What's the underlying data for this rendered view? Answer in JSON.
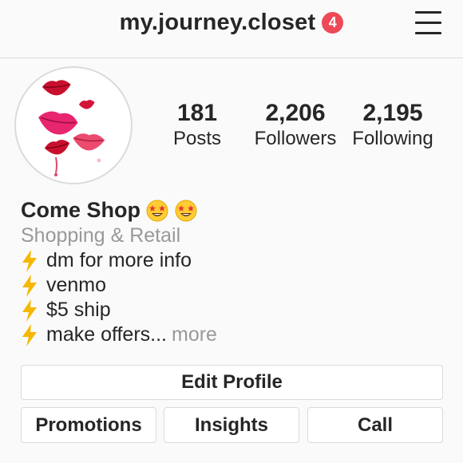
{
  "header": {
    "username": "my.journey.closet",
    "notification_count": "4",
    "menu_icon": "hamburger-menu-icon"
  },
  "profile": {
    "avatar_icon": "lips-illustration"
  },
  "stats": [
    {
      "value": "181",
      "label": "Posts"
    },
    {
      "value": "2,206",
      "label": "Followers"
    },
    {
      "value": "2,195",
      "label": "Following"
    }
  ],
  "bio": {
    "name": "Come Shop",
    "name_emoji": "star-struck-emoji",
    "category": "Shopping & Retail",
    "lines": [
      "dm for more info",
      "venmo",
      "$5 ship",
      "make offers..."
    ],
    "line_icon": "lightning-bolt-icon",
    "more_label": "more"
  },
  "buttons": {
    "edit_profile": "Edit Profile",
    "promotions": "Promotions",
    "insights": "Insights",
    "call": "Call"
  },
  "colors": {
    "badge": "#ed4956",
    "secondary_text": "#999999",
    "border": "#dbdbdb",
    "bolt": "#f5b700"
  }
}
